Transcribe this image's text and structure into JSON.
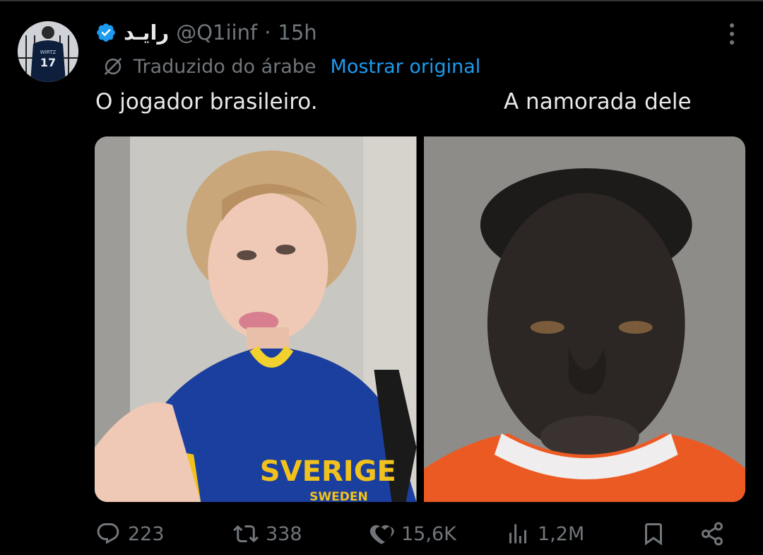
{
  "tweet": {
    "author": {
      "display_name": "رايـد",
      "handle": "@Q1iinf",
      "separator": "·",
      "time": "15h",
      "verified": true
    },
    "translation": {
      "label": "Traduzido do árabe",
      "show_original": "Mostrar original"
    },
    "captions": {
      "left": "O jogador brasileiro.",
      "right": "A namorada dele"
    },
    "media": {
      "left_shirt_text": "SVERIGE",
      "left_shirt_subtext": "SWEDEN",
      "avatar_jersey_name": "WIRTZ",
      "avatar_jersey_number": "17"
    },
    "stats": {
      "replies": "223",
      "reposts": "338",
      "likes": "15,6K",
      "views": "1,2M"
    }
  },
  "colors": {
    "background": "#000000",
    "text_primary": "#e7e9ea",
    "text_secondary": "#71767b",
    "accent": "#1d9bf0"
  },
  "icons": [
    "verified-badge-icon",
    "more-options-icon",
    "translate-icon",
    "reply-icon",
    "repost-icon",
    "like-icon",
    "views-icon",
    "bookmark-icon",
    "share-icon"
  ]
}
